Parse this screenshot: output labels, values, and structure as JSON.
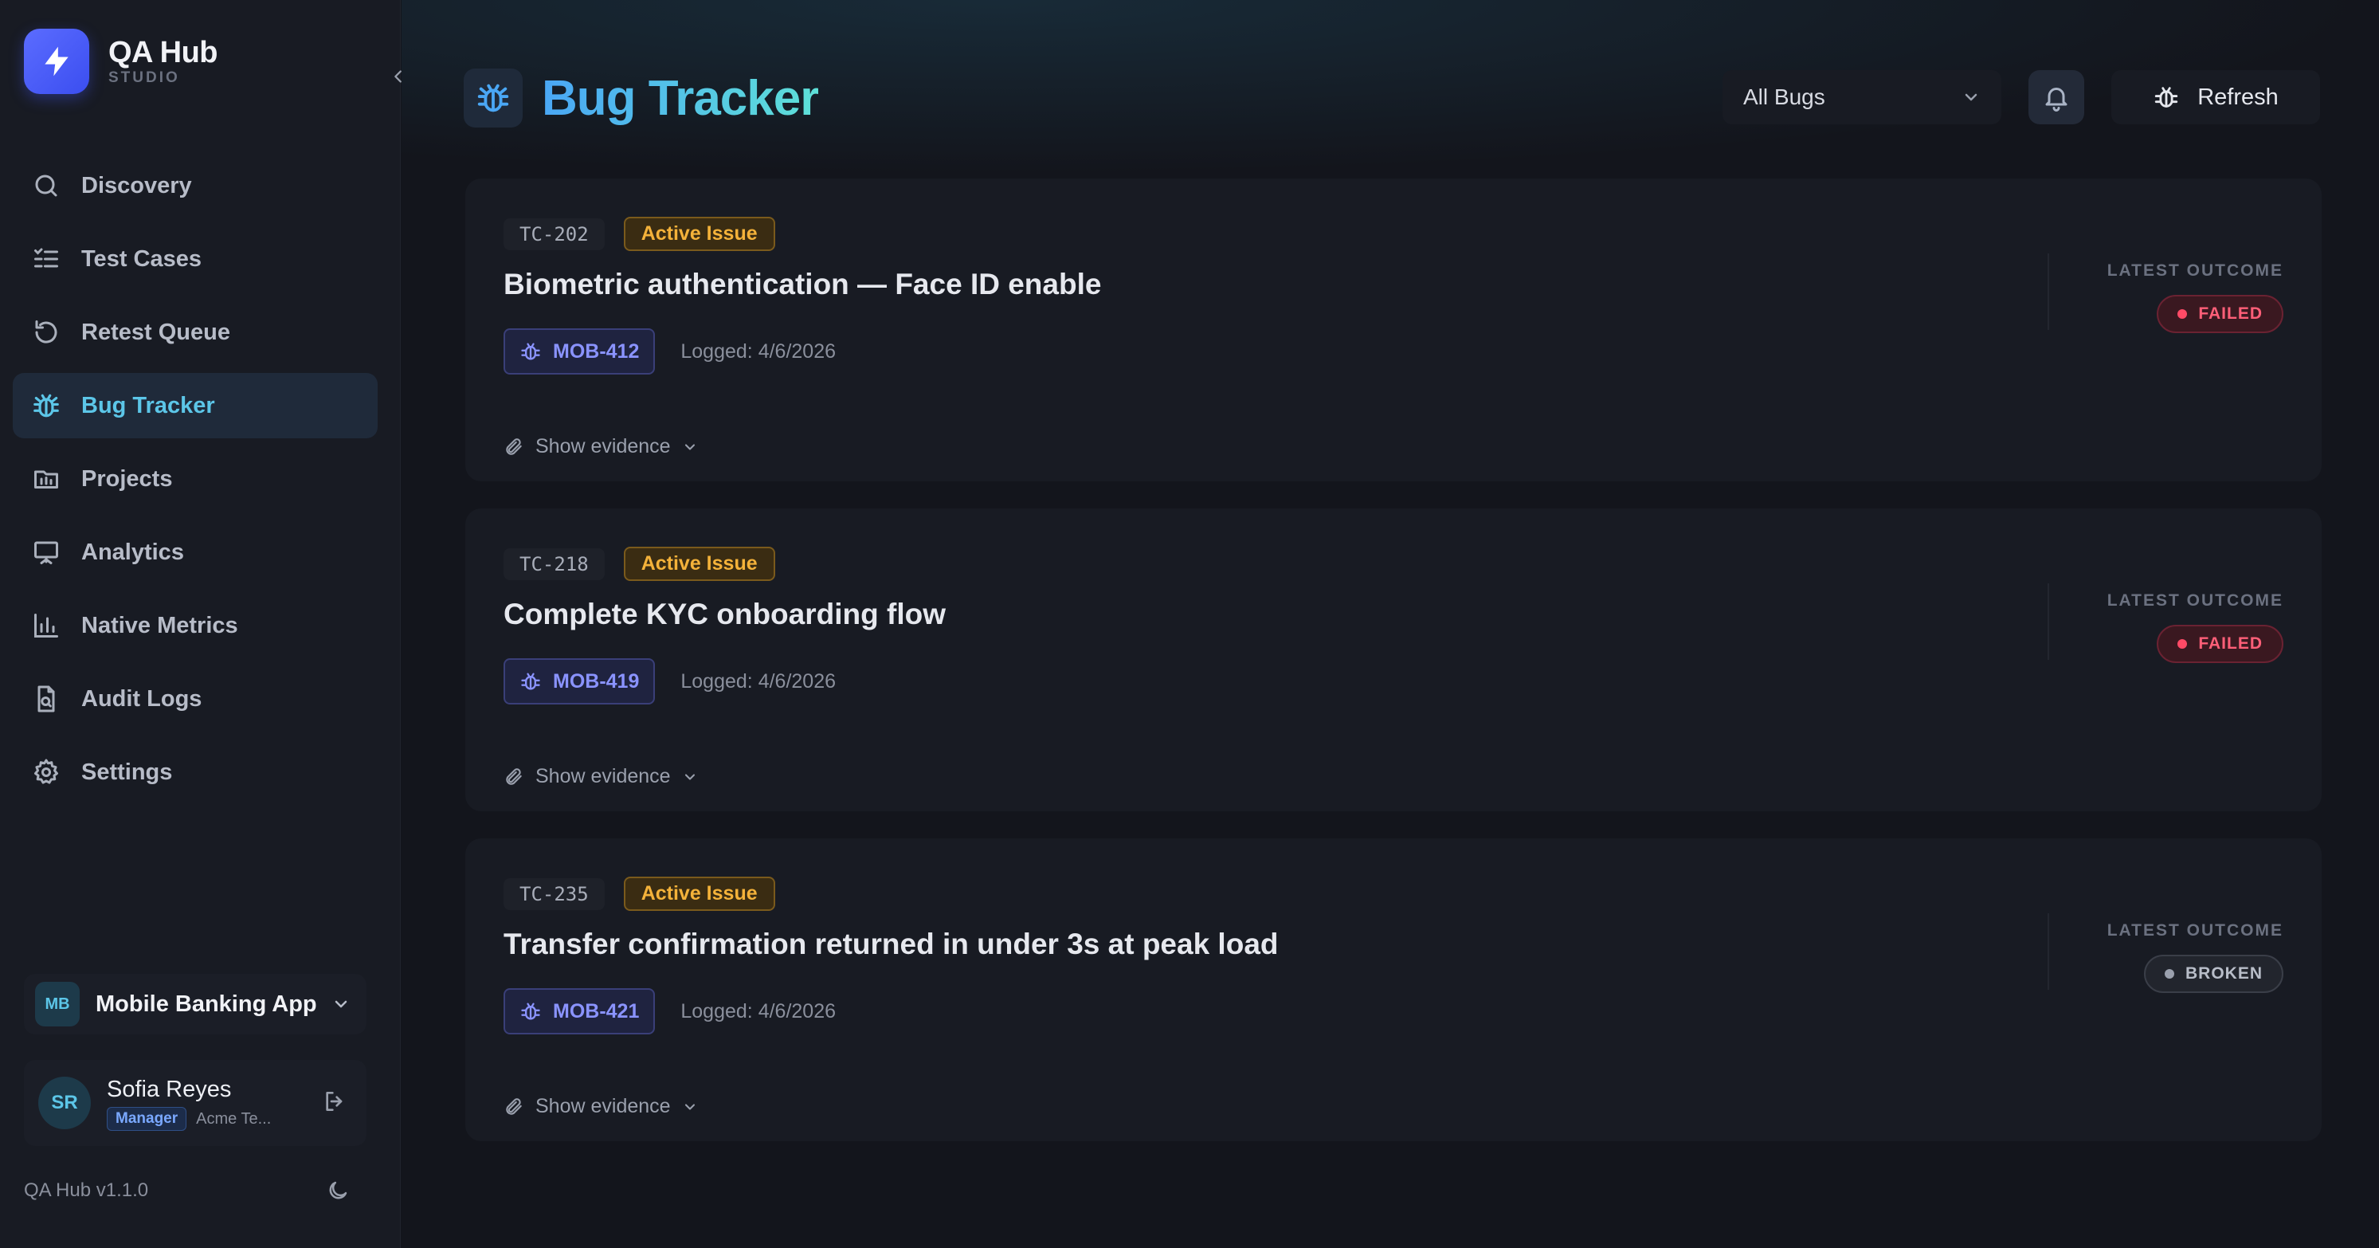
{
  "brand": {
    "title": "QA Hub",
    "subtitle": "STUDIO"
  },
  "sidebar": {
    "items": [
      {
        "label": "Discovery",
        "icon": "search-icon"
      },
      {
        "label": "Test Cases",
        "icon": "list-check-icon"
      },
      {
        "label": "Retest Queue",
        "icon": "rotate-ccw-icon"
      },
      {
        "label": "Bug Tracker",
        "icon": "bug-icon",
        "active": true
      },
      {
        "label": "Projects",
        "icon": "folder-chart-icon"
      },
      {
        "label": "Analytics",
        "icon": "presentation-icon"
      },
      {
        "label": "Native Metrics",
        "icon": "bar-chart-icon"
      },
      {
        "label": "Audit Logs",
        "icon": "file-search-icon"
      },
      {
        "label": "Settings",
        "icon": "gear-icon"
      }
    ],
    "project": {
      "initials": "MB",
      "name": "Mobile Banking App"
    },
    "user": {
      "initials": "SR",
      "name": "Sofia Reyes",
      "role": "Manager",
      "org": "Acme Te..."
    },
    "version": "QA Hub v1.1.0"
  },
  "header": {
    "title": "Bug Tracker",
    "filter_value": "All Bugs",
    "refresh_label": "Refresh"
  },
  "cards": [
    {
      "tc_id": "TC-202",
      "status": "Active Issue",
      "title": "Biometric authentication — Face ID enable",
      "bug_id": "MOB-412",
      "logged": "Logged: 4/6/2026",
      "evidence": "Show evidence",
      "outcome_label": "LATEST OUTCOME",
      "outcome": "FAILED"
    },
    {
      "tc_id": "TC-218",
      "status": "Active Issue",
      "title": "Complete KYC onboarding flow",
      "bug_id": "MOB-419",
      "logged": "Logged: 4/6/2026",
      "evidence": "Show evidence",
      "outcome_label": "LATEST OUTCOME",
      "outcome": "FAILED"
    },
    {
      "tc_id": "TC-235",
      "status": "Active Issue",
      "title": "Transfer confirmation returned in under 3s at peak load",
      "bug_id": "MOB-421",
      "logged": "Logged: 4/6/2026",
      "evidence": "Show evidence",
      "outcome_label": "LATEST OUTCOME",
      "outcome": "BROKEN"
    }
  ],
  "colors": {
    "accent": "#5cc6e8",
    "brand": "#4f5ff6",
    "warning": "#f4b23a",
    "failed": "#ff5f78",
    "bug_chip": "#8a93ff"
  }
}
